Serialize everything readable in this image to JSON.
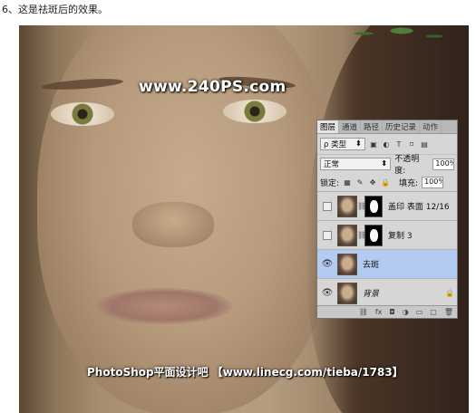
{
  "caption": "6、这是祛斑后的效果。",
  "watermark_top": "www.240PS.com",
  "watermark_bottom": "PhotoShop平面设计吧 【www.linecg.com/tieba/1783】",
  "layers_panel": {
    "tabs": [
      "图层",
      "通道",
      "路径",
      "历史记录",
      "动作"
    ],
    "filter_kind": "ρ 类型",
    "filter_icons": [
      "image-filter-icon",
      "adjustment-filter-icon",
      "text-filter-icon",
      "shape-filter-icon",
      "smart-object-filter-icon"
    ],
    "blend_mode": "正常",
    "opacity_label": "不透明度:",
    "opacity_value": "100%",
    "lock_label": "锁定:",
    "fill_label": "填充:",
    "fill_value": "100%",
    "layers": [
      {
        "name": "盖印 表面 12/16",
        "visible": false,
        "has_mask": true,
        "selected": false
      },
      {
        "name": "复制 3",
        "visible": false,
        "has_mask": true,
        "selected": false
      },
      {
        "name": "去斑",
        "visible": true,
        "has_mask": false,
        "selected": true
      },
      {
        "name": "背景",
        "visible": true,
        "has_mask": false,
        "selected": false,
        "locked": true
      }
    ],
    "bottom_icons": [
      "link-icon",
      "fx-icon",
      "add-mask-icon",
      "adjustment-layer-icon",
      "new-group-icon",
      "new-layer-icon",
      "delete-icon"
    ]
  }
}
